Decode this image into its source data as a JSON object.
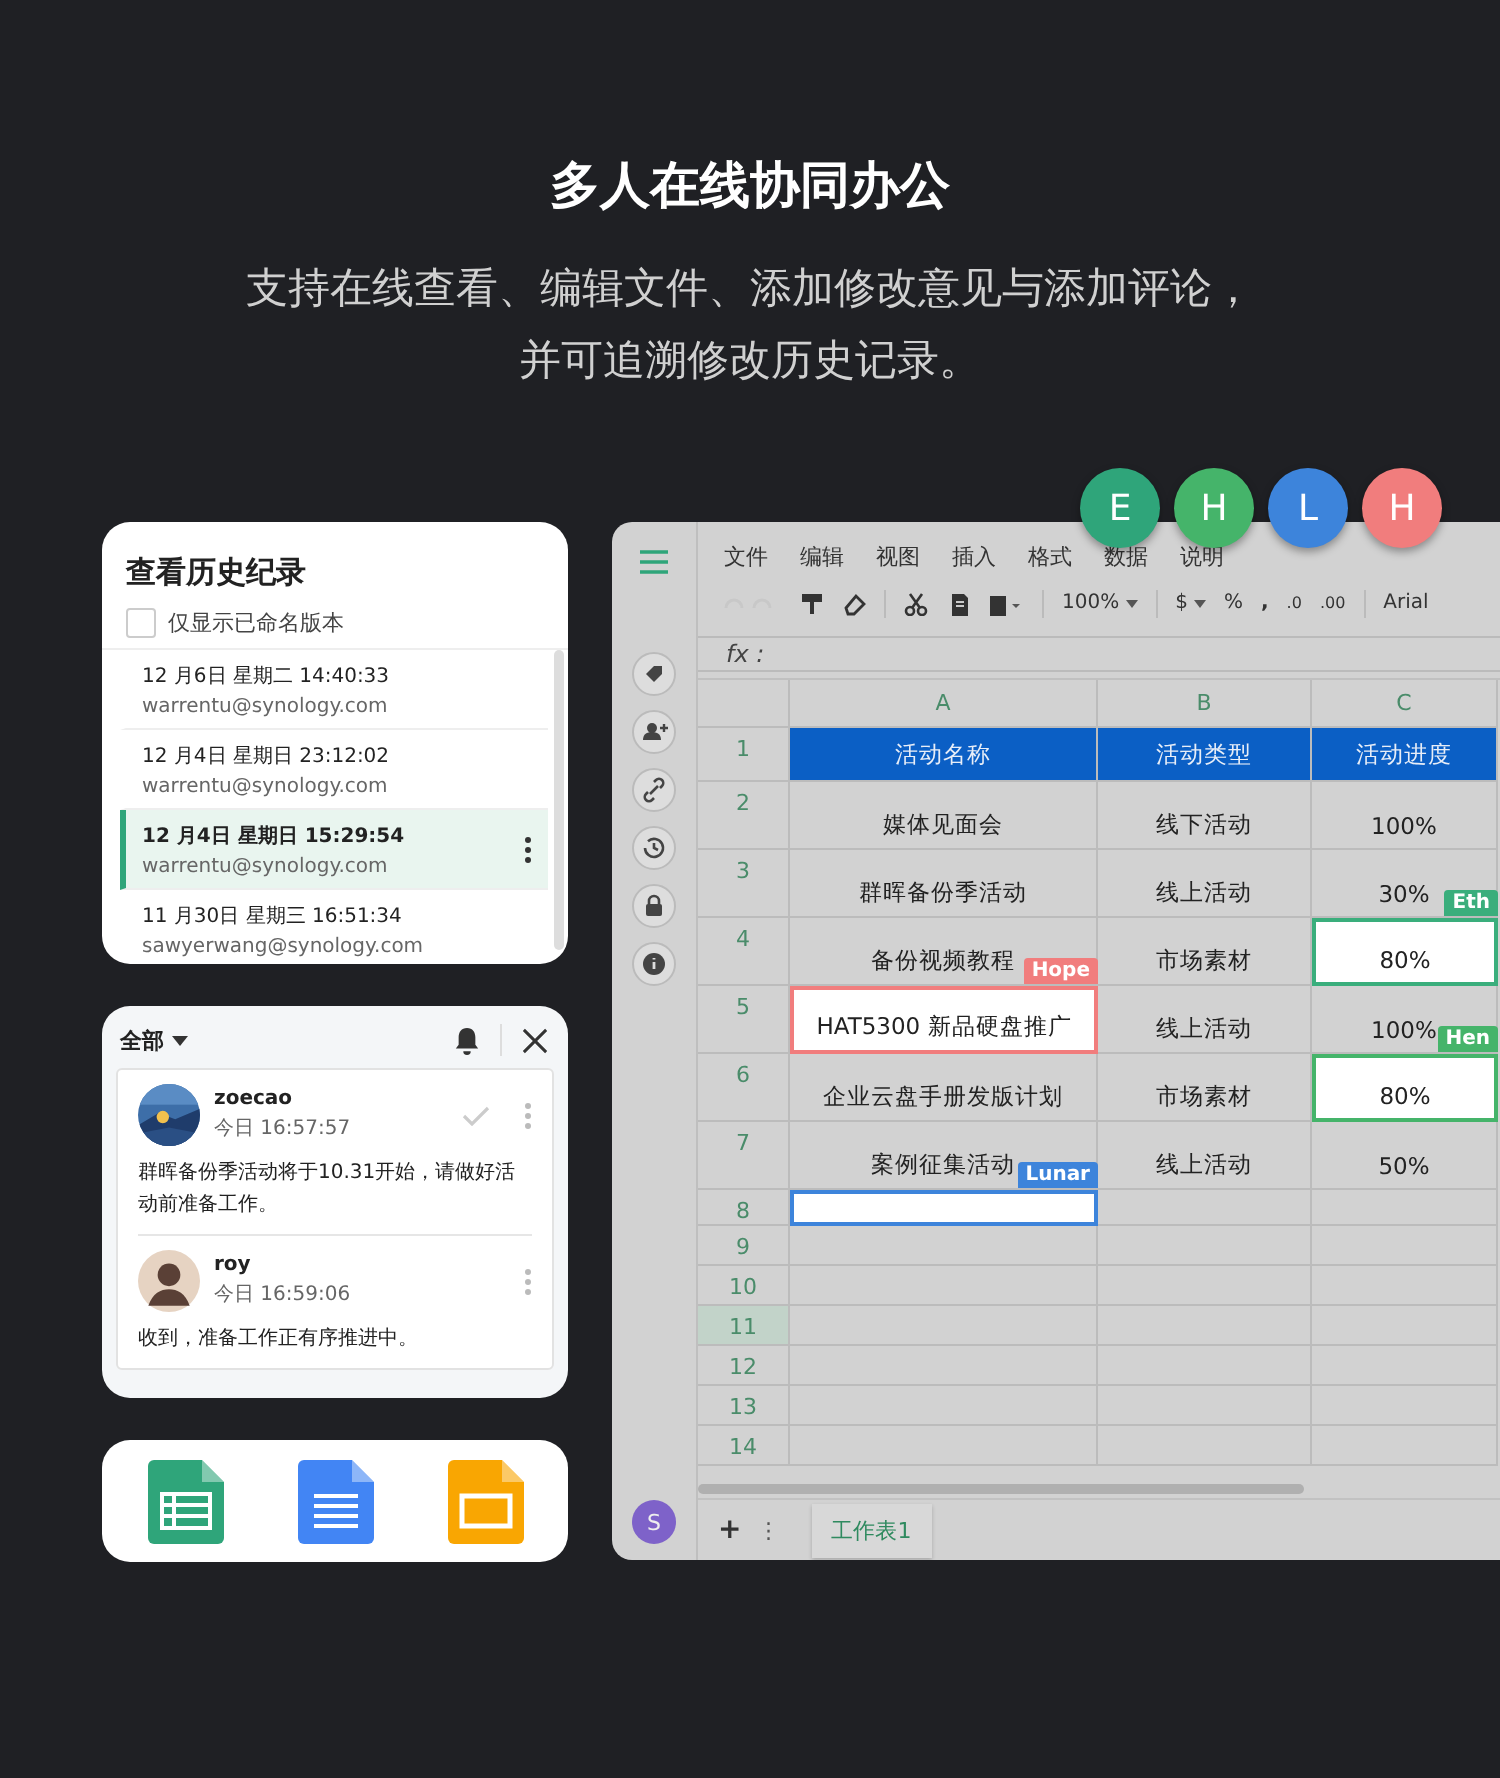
{
  "headline": "多人在线协同办公",
  "subtitle_lines": [
    "支持在线查看、编辑文件、添加修改意见与添加评论，",
    "并可追溯修改历史记录。"
  ],
  "history": {
    "title": "查看历史纪录",
    "named_only": {
      "label": "仅显示已命名版本",
      "checked": false
    },
    "versions": [
      {
        "date": "12 月6日 星期二 14:40:33",
        "user": "warrentu@synology.com",
        "selected": false
      },
      {
        "date": "12 月4日 星期日 23:12:02",
        "user": "warrentu@synology.com",
        "selected": false
      },
      {
        "date": "12 月4日 星期日 15:29:54",
        "user": "warrentu@synology.com",
        "selected": true
      },
      {
        "date": "11 月30日 星期三 16:51:34",
        "user": "sawyerwang@synology.com",
        "selected": false
      }
    ]
  },
  "comments": {
    "filter": "全部",
    "items": [
      {
        "user": "zoecao",
        "time": "今日 16:57:57",
        "text": "群晖备份季活动将于10.31开始，请做好活动前准备工作。",
        "kind": "picture"
      },
      {
        "user": "roy",
        "time": "今日 16:59:06",
        "text": "收到，准备工作正有序推进中。",
        "kind": "person"
      }
    ]
  },
  "apps": [
    {
      "kind": "sheet"
    },
    {
      "kind": "doc"
    },
    {
      "kind": "slides"
    }
  ],
  "collaborators": [
    {
      "initial": "E",
      "color": "#2fa57a"
    },
    {
      "initial": "H",
      "color": "#45b46a"
    },
    {
      "initial": "L",
      "color": "#3d84db"
    },
    {
      "initial": "H",
      "color": "#f17d7d"
    }
  ],
  "sheet": {
    "menu": [
      "文件",
      "编辑",
      "视图",
      "插入",
      "格式",
      "数据",
      "说明"
    ],
    "toolbar": {
      "zoom": "100%",
      "currency": "$",
      "percent": "%",
      "comma": ",",
      "decrease_decimal": ".0",
      "increase_decimal": ".00",
      "font": "Arial"
    },
    "formula_label": "fx :",
    "columns": [
      "A",
      "B",
      "C"
    ],
    "rows": [
      {
        "number": "1",
        "header": true,
        "selected": false,
        "cells": [
          {
            "text": "活动名称"
          },
          {
            "text": "活动类型"
          },
          {
            "text": "活动进度"
          }
        ]
      },
      {
        "number": "2",
        "header": false,
        "selected": false,
        "cells": [
          {
            "text": "媒体见面会"
          },
          {
            "text": "线下活动"
          },
          {
            "text": "100%"
          }
        ]
      },
      {
        "number": "3",
        "header": false,
        "selected": false,
        "cells": [
          {
            "text": "群晖备份季活动"
          },
          {
            "text": "线上活动"
          },
          {
            "text": "30%"
          }
        ]
      },
      {
        "number": "4",
        "header": false,
        "selected": false,
        "cells": [
          {
            "text": "备份视频教程"
          },
          {
            "text": "市场素材"
          },
          {
            "text": "80%",
            "cursor": {
              "name": "Eth",
              "color": "#3aae7c"
            }
          }
        ]
      },
      {
        "number": "5",
        "header": false,
        "selected": false,
        "cells": [
          {
            "text": "HAT5300 新品硬盘推广",
            "cursor": {
              "name": "Hope",
              "color": "#f17d7d"
            }
          },
          {
            "text": "线上活动"
          },
          {
            "text": "100%"
          }
        ]
      },
      {
        "number": "6",
        "header": false,
        "selected": false,
        "cells": [
          {
            "text": "企业云盘手册发版计划"
          },
          {
            "text": "市场素材"
          },
          {
            "text": "80%",
            "cursor": {
              "name": "Hen",
              "color": "#45b46a"
            }
          }
        ]
      },
      {
        "number": "7",
        "header": false,
        "selected": false,
        "cells": [
          {
            "text": "案例征集活动"
          },
          {
            "text": "线上活动"
          },
          {
            "text": "50%"
          }
        ]
      },
      {
        "number": "8",
        "header": false,
        "selected": false,
        "cells": [
          {
            "cursor": {
              "name": "Lunar",
              "color": "#3d84db"
            }
          },
          {},
          {}
        ]
      },
      {
        "number": "9",
        "header": false,
        "selected": false,
        "cells": [
          {},
          {},
          {}
        ]
      },
      {
        "number": "10",
        "header": false,
        "selected": false,
        "cells": [
          {},
          {},
          {}
        ]
      },
      {
        "number": "11",
        "header": false,
        "selected": true,
        "cells": [
          {},
          {},
          {}
        ]
      },
      {
        "number": "12",
        "header": false,
        "selected": false,
        "cells": [
          {},
          {},
          {}
        ]
      },
      {
        "number": "13",
        "header": false,
        "selected": false,
        "cells": [
          {},
          {},
          {}
        ]
      },
      {
        "number": "14",
        "header": false,
        "selected": false,
        "cells": [
          {},
          {},
          {}
        ]
      }
    ],
    "user_initial": "S",
    "add_sheet": "+",
    "sheet_menu": "⋮",
    "tabs": [
      {
        "label": "工作表1",
        "selected": true
      }
    ]
  }
}
